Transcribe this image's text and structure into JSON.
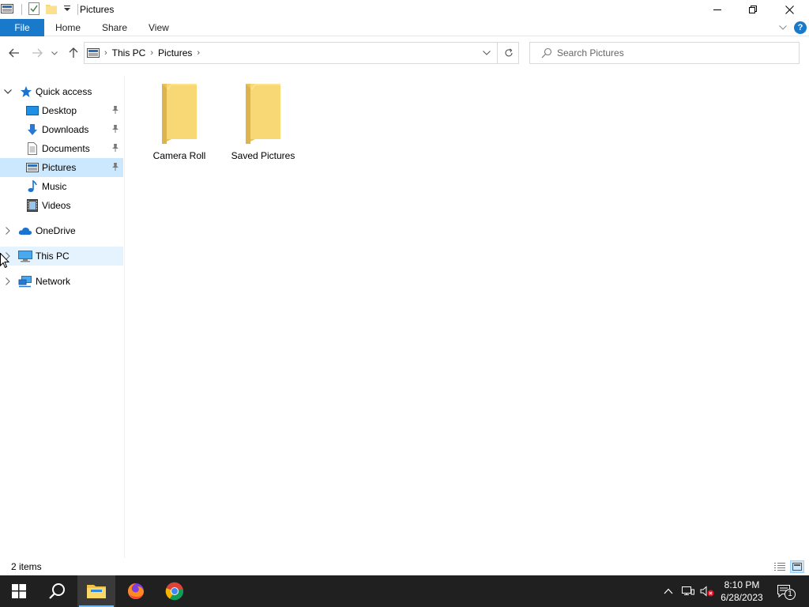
{
  "window": {
    "title": "Pictures",
    "minimize_glyph": "—",
    "maximize_glyph": "❐",
    "close_glyph": "✕"
  },
  "ribbon": {
    "tabs": [
      {
        "label": "File"
      },
      {
        "label": "Home"
      },
      {
        "label": "Share"
      },
      {
        "label": "View"
      }
    ],
    "expand_glyph": "⌄",
    "help_glyph": "?"
  },
  "nav": {
    "breadcrumb": [
      "This PC",
      "Pictures"
    ],
    "search_placeholder": "Search Pictures"
  },
  "sidebar": {
    "items": [
      {
        "label": "Quick access",
        "icon": "star-icon"
      },
      {
        "label": "Desktop",
        "icon": "desktop-icon",
        "pinned": true
      },
      {
        "label": "Downloads",
        "icon": "download-icon",
        "pinned": true
      },
      {
        "label": "Documents",
        "icon": "document-icon",
        "pinned": true
      },
      {
        "label": "Pictures",
        "icon": "pictures-icon",
        "pinned": true,
        "selected": true
      },
      {
        "label": "Music",
        "icon": "music-icon"
      },
      {
        "label": "Videos",
        "icon": "videos-icon"
      },
      {
        "label": "OneDrive",
        "icon": "cloud-icon"
      },
      {
        "label": "This PC",
        "icon": "computer-icon"
      },
      {
        "label": "Network",
        "icon": "network-icon"
      }
    ]
  },
  "content": {
    "folders": [
      {
        "name": "Camera Roll"
      },
      {
        "name": "Saved Pictures"
      }
    ]
  },
  "status": {
    "item_count": "2 items"
  },
  "taskbar": {
    "time": "8:10 PM",
    "date": "6/28/2023",
    "notification_count": "1"
  },
  "colors": {
    "accent": "#1979ca",
    "selection": "#cce8ff",
    "folder": "#f8d775",
    "taskbar": "#202020"
  }
}
